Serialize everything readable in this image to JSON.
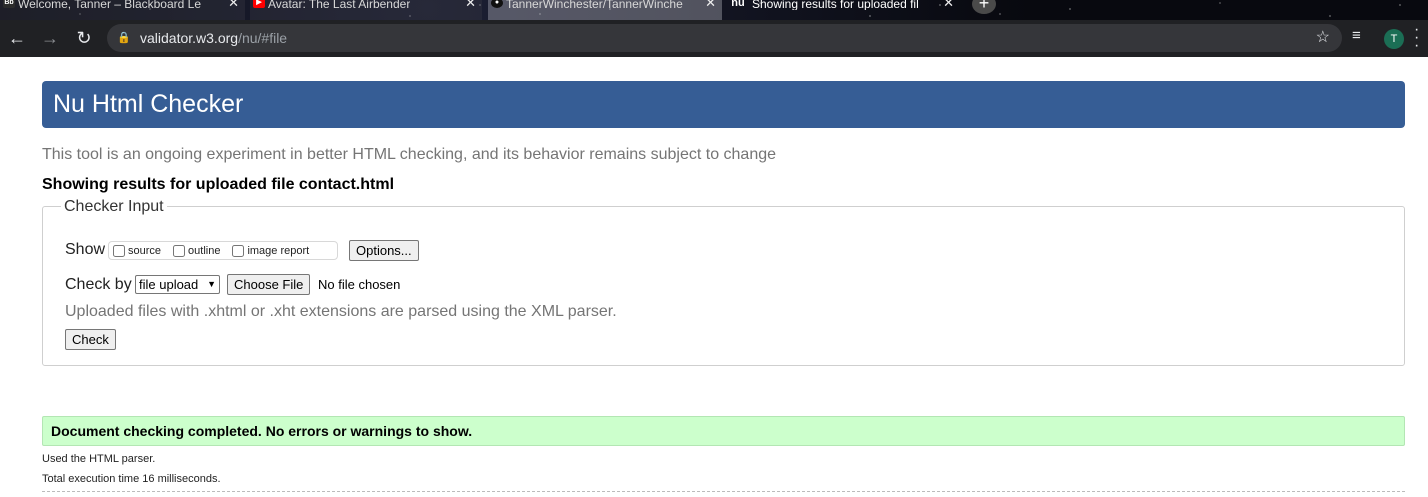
{
  "browser": {
    "tabs": [
      {
        "title": "Welcome, Tanner – Blackboard Le",
        "favicon": "Bb",
        "favicon_color": "#2b2b2b",
        "active": false
      },
      {
        "title": "Avatar: The Last Airbender",
        "favicon": "youtube-icon",
        "favicon_color": "#ff0000",
        "active": false
      },
      {
        "title": "TannerWinchester/TannerWinche",
        "favicon": "github-icon",
        "favicon_color": "#000000",
        "active": false
      },
      {
        "title": "Showing results for uploaded fil",
        "favicon": "nu",
        "favicon_color": "#365d95",
        "active": true
      }
    ],
    "url_host": "validator.w3.org",
    "url_path": "/nu/#file",
    "profile_initial": "T"
  },
  "page": {
    "title": "Nu Html Checker",
    "subtitle": "This tool is an ongoing experiment in better HTML checking, and its behavior remains subject to change",
    "results_heading": "Showing results for uploaded file contact.html",
    "checker_input": {
      "legend": "Checker Input",
      "show_label": "Show",
      "show_options": [
        "source",
        "outline",
        "image report"
      ],
      "options_button": "Options...",
      "check_by_label": "Check by",
      "check_by_value": "file upload",
      "choose_file_button": "Choose File",
      "no_file_text": "No file chosen",
      "note": "Uploaded files with .xhtml or .xht extensions are parsed using the XML parser.",
      "check_button": "Check"
    },
    "result_message": "Document checking completed. No errors or warnings to show.",
    "parser_info": "Used the HTML parser.",
    "execution_time": "Total execution time 16 milliseconds."
  },
  "colors": {
    "header_bg": "#365d95",
    "success_bg": "#ccffcc"
  }
}
